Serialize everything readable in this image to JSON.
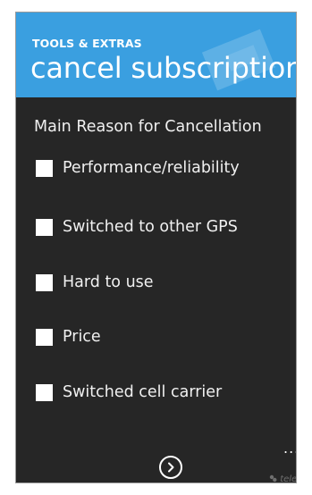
{
  "header": {
    "section_label": "TOOLS & EXTRAS",
    "title": "cancel subscription",
    "background_color": "#3a9fe0"
  },
  "form": {
    "question": "Main Reason for Cancellation",
    "options": [
      {
        "label": "Performance/reliability",
        "checked": false
      },
      {
        "label": "Switched to other GPS",
        "checked": false
      },
      {
        "label": "Hard to use",
        "checked": false
      },
      {
        "label": "Price",
        "checked": false
      },
      {
        "label": "Switched cell carrier",
        "checked": false
      }
    ]
  },
  "app_bar": {
    "next_icon": "chevron-right-circle-icon",
    "more_label": "...",
    "brand_text": "telenav"
  },
  "colors": {
    "screen_background": "#262626",
    "text": "#f0f0f0"
  }
}
